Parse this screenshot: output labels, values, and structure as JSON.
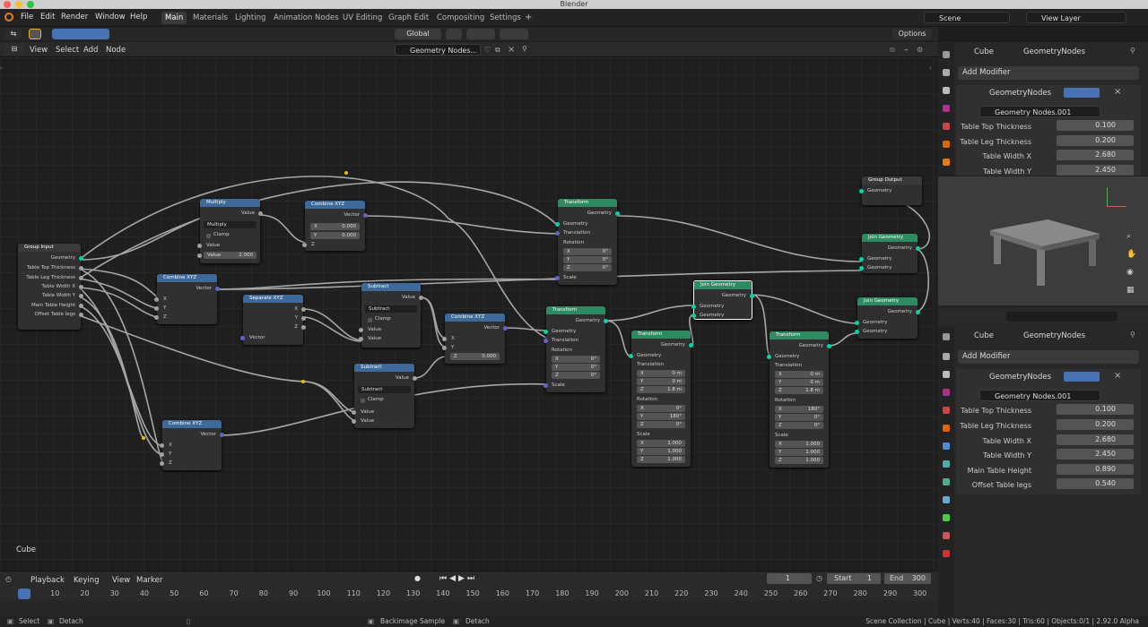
{
  "window": {
    "title": "Blender"
  },
  "menu": {
    "items": [
      "File",
      "Edit",
      "Render",
      "Window",
      "Help"
    ]
  },
  "workspaces": [
    "Main",
    "Materials",
    "Lighting",
    "Animation Nodes",
    "UV Editing",
    "Graph Edit",
    "Compositing",
    "Settings"
  ],
  "topright": {
    "scene": "Scene",
    "view_layer": "View Layer"
  },
  "toolbar": {
    "orientation": "Global",
    "options": "Options"
  },
  "node_header": {
    "menu": [
      "View",
      "Select",
      "Add",
      "Node"
    ],
    "tree_name": "Geometry Nodes..."
  },
  "editor": {
    "object_label": "Cube"
  },
  "nodes": {
    "group_input": {
      "title": "Group Input",
      "outputs": [
        "Geometry",
        "Table Top Thickness",
        "Table Leg Thickness",
        "Table Width X",
        "Table Width Y",
        "Main Table Height",
        "Offset Table legs"
      ]
    },
    "multiply": {
      "title": "Multiply",
      "out": "Value",
      "op": "Multiply",
      "clamp": "Clamp",
      "in1": "Value",
      "in2_label": "Value",
      "in2_value": "2.000"
    },
    "combine1": {
      "title": "Combine XYZ",
      "out": "Vector",
      "x_label": "X",
      "x": "0.000",
      "y_label": "Y",
      "y": "0.000",
      "z": "Z"
    },
    "combine2": {
      "title": "Combine XYZ",
      "out": "Vector",
      "x": "X",
      "y": "Y",
      "z": "Z"
    },
    "separate": {
      "title": "Separate XYZ",
      "x": "X",
      "y": "Y",
      "z": "Z",
      "in": "Vector"
    },
    "subtract1": {
      "title": "Subtract",
      "out": "Value",
      "op": "Subtract",
      "clamp": "Clamp",
      "in1": "Value",
      "in2": "Value"
    },
    "combine3": {
      "title": "Combine XYZ",
      "out": "Vector",
      "x": "X",
      "y": "Y",
      "z_label": "Z",
      "z": "0.000"
    },
    "subtract2": {
      "title": "Subtract",
      "out": "Value",
      "op": "Subtract",
      "clamp": "Clamp",
      "in1": "Value",
      "in2": "Value"
    },
    "combine4": {
      "title": "Combine XYZ",
      "out": "Vector",
      "x": "X",
      "y": "Y",
      "z": "Z"
    },
    "transform1": {
      "title": "Transform",
      "out": "Geometry",
      "in": "Geometry",
      "translation": "Translation",
      "rotation": "Rotation",
      "rx": "0°",
      "ry": "0°",
      "rz": "0°",
      "scale": "Scale"
    },
    "transform2": {
      "title": "Transform",
      "out": "Geometry",
      "in": "Geometry",
      "translation": "Translation",
      "rotation": "Rotation",
      "rx": "0°",
      "ry": "0°",
      "rz": "0°",
      "scale": "Scale"
    },
    "transform3": {
      "title": "Transform",
      "out": "Geometry",
      "in": "Geometry",
      "translation": "Translation",
      "tx": "0 m",
      "ty": "0 m",
      "tz": "1.8 m",
      "rotation": "Rotation",
      "rx": "0°",
      "ry": "180°",
      "rz": "0°",
      "scale": "Scale",
      "sx": "1.000",
      "sy": "1.000",
      "sz": "1.000"
    },
    "transform4": {
      "title": "Transform",
      "out": "Geometry",
      "in": "Geometry",
      "translation": "Translation",
      "tx": "0 m",
      "ty": "0 m",
      "tz": "1.8 m",
      "rotation": "Rotation",
      "rx": "180°",
      "ry": "0°",
      "rz": "0°",
      "scale": "Scale",
      "sx": "1.000",
      "sy": "1.000",
      "sz": "1.000"
    },
    "join1": {
      "title": "Join Geometry",
      "out": "Geometry",
      "in1": "Geometry",
      "in2": "Geometry"
    },
    "join2": {
      "title": "Join Geometry",
      "out": "Geometry",
      "in1": "Geometry",
      "in2": "Geometry"
    },
    "join3": {
      "title": "Join Geometry",
      "out": "Geometry",
      "in1": "Geometry",
      "in2": "Geometry"
    },
    "group_output": {
      "title": "Group Output",
      "in": "Geometry"
    },
    "axis": {
      "x": "X",
      "y": "Y",
      "z": "Z"
    }
  },
  "timeline": {
    "menu": [
      "Playback",
      "Keying",
      "View",
      "Marker"
    ],
    "current": "1",
    "start_label": "Start",
    "start": "1",
    "end_label": "End",
    "end": "300",
    "ticks": [
      "1",
      "10",
      "20",
      "30",
      "40",
      "50",
      "60",
      "70",
      "80",
      "90",
      "100",
      "110",
      "120",
      "130",
      "140",
      "150",
      "160",
      "170",
      "180",
      "190",
      "200",
      "210",
      "220",
      "230",
      "240",
      "250",
      "260",
      "270",
      "280",
      "290",
      "300"
    ]
  },
  "status": {
    "select": "Select",
    "detach": "Detach",
    "backimage": "Backimage Sample",
    "detach2": "Detach",
    "info": "Scene Collection | Cube | Verts:40 | Faces:30 | Tris:60 | Objects:0/1 | 2.92.0 Alpha"
  },
  "props_top": {
    "object": "Cube",
    "modifier_tab": "GeometryNodes",
    "add_modifier": "Add Modifier",
    "modifier_name": "GeometryNodes",
    "group": "Geometry Nodes.001",
    "fields": [
      {
        "label": "Table Top Thickness",
        "value": "0.100"
      },
      {
        "label": "Table Leg Thickness",
        "value": "0.200"
      },
      {
        "label": "Table Width X",
        "value": "2.680"
      },
      {
        "label": "Table Width Y",
        "value": "2.450"
      }
    ]
  },
  "props_bottom": {
    "object": "Cube",
    "modifier_tab": "GeometryNodes",
    "add_modifier": "Add Modifier",
    "modifier_name": "GeometryNodes",
    "group": "Geometry Nodes.001",
    "fields": [
      {
        "label": "Table Top Thickness",
        "value": "0.100"
      },
      {
        "label": "Table Leg Thickness",
        "value": "0.200"
      },
      {
        "label": "Table Width X",
        "value": "2.680"
      },
      {
        "label": "Table Width Y",
        "value": "2.450"
      },
      {
        "label": "Main Table Height",
        "value": "0.890"
      },
      {
        "label": "Offset Table legs",
        "value": "0.540"
      }
    ]
  },
  "colors": {
    "geometry_socket": "#00d6a3",
    "vector_socket": "#6363c7",
    "value_socket": "#a1a1a1",
    "math_header": "#3e6a9a",
    "geo_header": "#2e8a62"
  }
}
